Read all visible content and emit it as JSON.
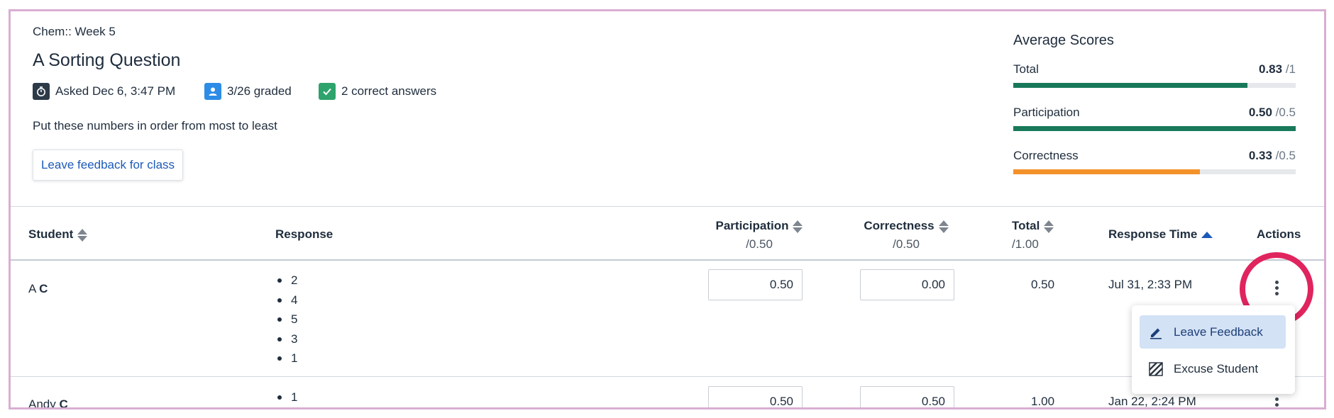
{
  "header": {
    "course": "Chem:: Week 5",
    "title": "A Sorting Question",
    "asked": "Asked Dec 6, 3:47 PM",
    "graded": "3/26 graded",
    "correct": "2 correct answers",
    "prompt": "Put these numbers in order from most to least",
    "feedback_button": "Leave feedback for class"
  },
  "averages": {
    "title": "Average Scores",
    "rows": [
      {
        "label": "Total",
        "value": "0.83",
        "denom": "/1",
        "fraction": 0.83,
        "color": "#17785a"
      },
      {
        "label": "Participation",
        "value": "0.50",
        "denom": "/0.5",
        "fraction": 1.0,
        "color": "#17785a"
      },
      {
        "label": "Correctness",
        "value": "0.33",
        "denom": "/0.5",
        "fraction": 0.66,
        "color": "#f4922a"
      }
    ]
  },
  "table": {
    "headers": {
      "student": "Student",
      "response": "Response",
      "participation": "Participation",
      "participation_sub": "/0.50",
      "correctness": "Correctness",
      "correctness_sub": "/0.50",
      "total": "Total",
      "total_sub": "/1.00",
      "response_time": "Response Time",
      "actions": "Actions"
    },
    "rows": [
      {
        "first": "A",
        "last": "C",
        "response": [
          "2",
          "4",
          "5",
          "3",
          "1"
        ],
        "participation": "0.50",
        "correctness": "0.00",
        "total": "0.50",
        "time": "Jul 31, 2:33 PM"
      },
      {
        "first": "Andy",
        "last": "C",
        "response": [
          "1"
        ],
        "participation": "0.50",
        "correctness": "0.50",
        "total": "1.00",
        "time": "Jan 22, 2:24 PM"
      }
    ]
  },
  "action_menu": {
    "items": [
      {
        "label": "Leave Feedback",
        "icon": "pencil-icon"
      },
      {
        "label": "Excuse Student",
        "icon": "hatch-icon"
      }
    ]
  },
  "colors": {
    "accent": "#1c5ab8",
    "highlight_ring": "#e0245e",
    "graded_icon": "#2d8ce6",
    "correct_icon": "#2ea36b",
    "clock_icon": "#2d3a48"
  }
}
